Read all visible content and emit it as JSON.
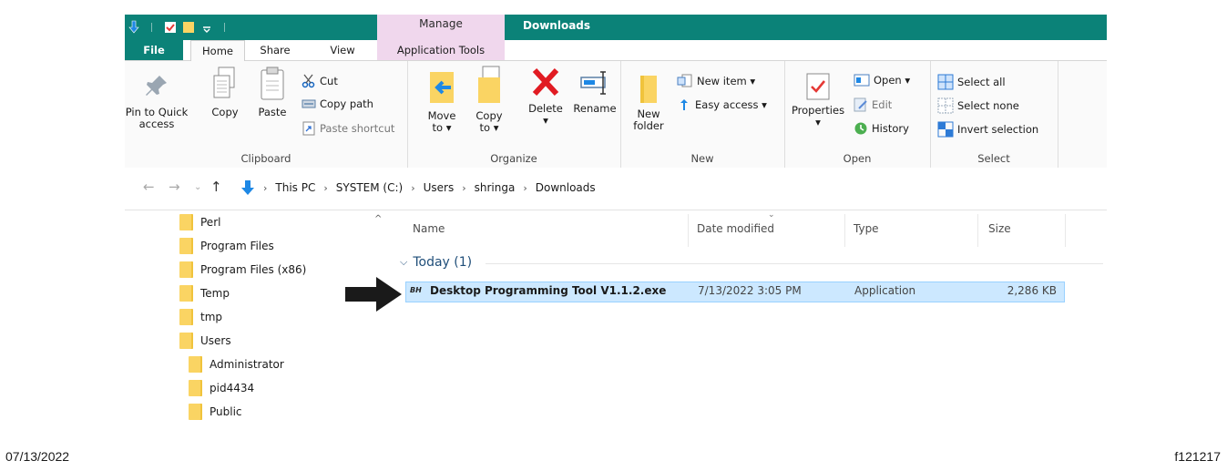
{
  "titlebar": {
    "context_tab": "Manage",
    "window_title": "Downloads"
  },
  "tabs": {
    "file": "File",
    "home": "Home",
    "share": "Share",
    "view": "View",
    "app_tools": "Application Tools"
  },
  "ribbon": {
    "clipboard": {
      "title": "Clipboard",
      "pin": [
        "Pin to Quick",
        "access"
      ],
      "copy": "Copy",
      "paste": "Paste",
      "cut": "Cut",
      "copy_path": "Copy path",
      "paste_shortcut": "Paste shortcut"
    },
    "organize": {
      "title": "Organize",
      "move_to": [
        "Move",
        "to ▾"
      ],
      "copy_to": [
        "Copy",
        "to ▾"
      ],
      "delete": "Delete",
      "rename": "Rename"
    },
    "new": {
      "title": "New",
      "new_folder": [
        "New",
        "folder"
      ],
      "new_item": "New item ▾",
      "easy_access": "Easy access ▾"
    },
    "open": {
      "title": "Open",
      "properties": "Properties",
      "open": "Open ▾",
      "edit": "Edit",
      "history": "History"
    },
    "select": {
      "title": "Select",
      "select_all": "Select all",
      "select_none": "Select none",
      "invert": "Invert selection"
    }
  },
  "address": {
    "crumbs": [
      "This PC",
      "SYSTEM (C:)",
      "Users",
      "shringa",
      "Downloads"
    ]
  },
  "nav_tree": [
    {
      "label": "Perl",
      "indent": 0
    },
    {
      "label": "Program Files",
      "indent": 0
    },
    {
      "label": "Program Files (x86)",
      "indent": 0
    },
    {
      "label": "Temp",
      "indent": 0
    },
    {
      "label": "tmp",
      "indent": 0
    },
    {
      "label": "Users",
      "indent": 0
    },
    {
      "label": "Administrator",
      "indent": 1
    },
    {
      "label": "pid4434",
      "indent": 1
    },
    {
      "label": "Public",
      "indent": 1
    }
  ],
  "columns": {
    "name": "Name",
    "date": "Date modified",
    "type": "Type",
    "size": "Size"
  },
  "group": {
    "label": "Today (1)"
  },
  "file": {
    "name": "Desktop Programming Tool V1.1.2.exe",
    "date": "7/13/2022 3:05 PM",
    "type": "Application",
    "size": "2,286 KB",
    "icon_text": "BH"
  },
  "footer": {
    "date": "07/13/2022",
    "figure_id": "f121217"
  }
}
